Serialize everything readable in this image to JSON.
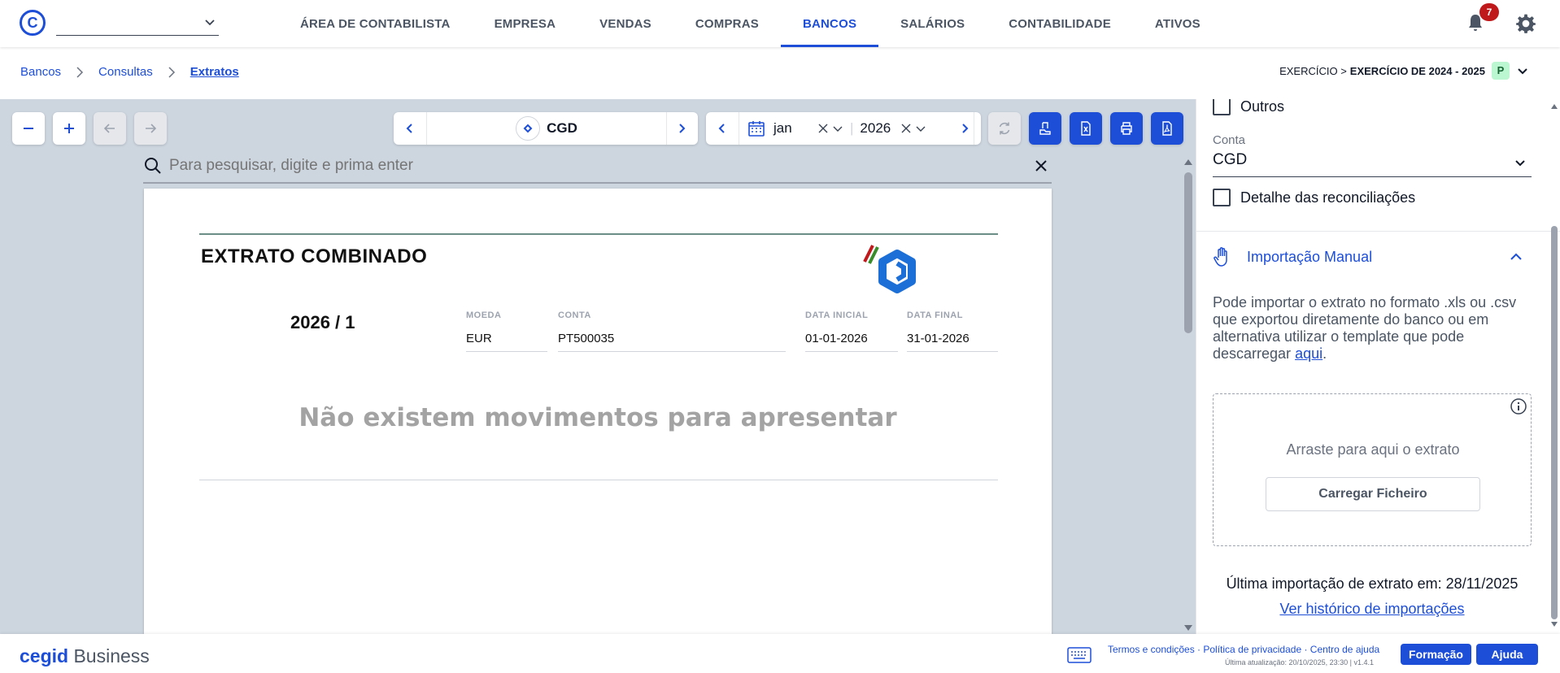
{
  "topbar": {
    "logo_letter": "C",
    "company_value": "",
    "nav": [
      "ÁREA DE CONTABILISTA",
      "EMPRESA",
      "VENDAS",
      "COMPRAS",
      "BANCOS",
      "SALÁRIOS",
      "CONTABILIDADE",
      "ATIVOS"
    ],
    "active_nav": "BANCOS",
    "notifications_count": "7"
  },
  "breadcrumb": {
    "items": [
      "Bancos",
      "Consultas"
    ],
    "current": "Extratos"
  },
  "exercise": {
    "prefix": "EXERCÍCIO >",
    "value": "EXERCÍCIO DE 2024 - 2025",
    "badge": "P"
  },
  "toolbar": {
    "bank": "CGD",
    "month": "jan",
    "year": "2026"
  },
  "search": {
    "placeholder": "Para pesquisar, digite e prima enter"
  },
  "document": {
    "title": "EXTRATO COMBINADO",
    "period": "2026 / 1",
    "fields": [
      {
        "label": "MOEDA",
        "value": "EUR"
      },
      {
        "label": "CONTA",
        "value": "PT500035"
      },
      {
        "label": "DATA INICIAL",
        "value": "01-01-2026"
      },
      {
        "label": "DATA FINAL",
        "value": "31-01-2026"
      }
    ],
    "empty_message": "Não existem movimentos para apresentar"
  },
  "side_panel": {
    "outros_label": "Outros",
    "conta_label": "Conta",
    "conta_value": "CGD",
    "detalhe_label": "Detalhe das reconciliações",
    "import_title": "Importação Manual",
    "import_text": "Pode importar o extrato no formato .xls ou .csv que exportou diretamente do banco ou em alternativa utilizar o template que pode descarregar ",
    "import_link": "aqui",
    "drop_text": "Arraste para aqui o extrato",
    "upload_button": "Carregar Ficheiro",
    "last_import": "Última importação de extrato em: 28/11/2025",
    "history_link": "Ver histórico de importações"
  },
  "footer": {
    "brand_bold": "cegid",
    "brand_rest": "Business",
    "links": "Termos e condições · Política de privacidade · Centro de ajuda",
    "updated": "Última atualização: 20/10/2025, 23:30 | v1.4.1",
    "formacao": "Formação",
    "ajuda": "Ajuda"
  },
  "colors": {
    "accent": "#1d4ed8",
    "badge_red": "#c0191c",
    "viewer_bg": "#cdd5df"
  }
}
